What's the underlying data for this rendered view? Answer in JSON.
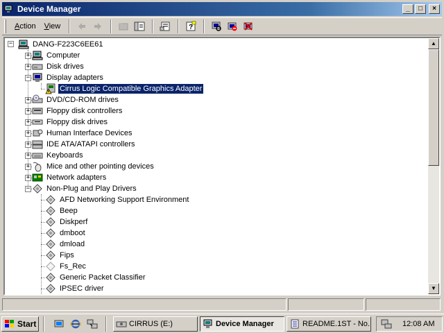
{
  "window": {
    "title": "Device Manager",
    "icon": "device-manager-icon",
    "controls": {
      "minimize": "_",
      "maximize": "□",
      "close": "×"
    }
  },
  "toolbar": {
    "menu": [
      {
        "label": "Action",
        "accel": "A"
      },
      {
        "label": "View",
        "accel": "V"
      }
    ],
    "buttons": [
      {
        "name": "back-icon",
        "enabled": false
      },
      {
        "name": "forward-icon",
        "enabled": false
      },
      {
        "name": "up-folder-icon",
        "enabled": false
      },
      {
        "name": "show-hide-tree-icon",
        "enabled": true
      },
      {
        "name": "properties-icon",
        "enabled": true
      },
      {
        "name": "help-icon",
        "enabled": true
      },
      {
        "name": "scan-hardware-icon",
        "enabled": true
      },
      {
        "name": "disable-device-icon",
        "enabled": true
      },
      {
        "name": "uninstall-device-icon",
        "enabled": true
      }
    ]
  },
  "tree": {
    "root": "DANG-F223C6EE61",
    "items": [
      {
        "label": "Computer",
        "level": 1,
        "expander": "+",
        "icon": "computer-icon"
      },
      {
        "label": "Disk drives",
        "level": 1,
        "expander": "+",
        "icon": "disk-drive-icon"
      },
      {
        "label": "Display adapters",
        "level": 1,
        "expander": "-",
        "icon": "display-adapter-icon"
      },
      {
        "label": "Cirrus Logic Compatible Graphics Adapter",
        "level": 2,
        "expander": "",
        "icon": "warning-adapter-icon",
        "selected": true
      },
      {
        "label": "DVD/CD-ROM drives",
        "level": 1,
        "expander": "+",
        "icon": "cdrom-icon"
      },
      {
        "label": "Floppy disk controllers",
        "level": 1,
        "expander": "+",
        "icon": "floppy-controller-icon"
      },
      {
        "label": "Floppy disk drives",
        "level": 1,
        "expander": "+",
        "icon": "floppy-drive-icon"
      },
      {
        "label": "Human Interface Devices",
        "level": 1,
        "expander": "+",
        "icon": "hid-icon"
      },
      {
        "label": "IDE ATA/ATAPI controllers",
        "level": 1,
        "expander": "+",
        "icon": "ide-controller-icon"
      },
      {
        "label": "Keyboards",
        "level": 1,
        "expander": "+",
        "icon": "keyboard-icon"
      },
      {
        "label": "Mice and other pointing devices",
        "level": 1,
        "expander": "+",
        "icon": "mouse-icon"
      },
      {
        "label": "Network adapters",
        "level": 1,
        "expander": "+",
        "icon": "network-adapter-icon"
      },
      {
        "label": "Non-Plug and Play Drivers",
        "level": 1,
        "expander": "-",
        "icon": "driver-icon"
      },
      {
        "label": "AFD Networking Support Environment",
        "level": 2,
        "expander": "",
        "icon": "driver-icon"
      },
      {
        "label": "Beep",
        "level": 2,
        "expander": "",
        "icon": "driver-icon"
      },
      {
        "label": "Diskperf",
        "level": 2,
        "expander": "",
        "icon": "driver-icon"
      },
      {
        "label": "dmboot",
        "level": 2,
        "expander": "",
        "icon": "driver-icon"
      },
      {
        "label": "dmload",
        "level": 2,
        "expander": "",
        "icon": "driver-icon"
      },
      {
        "label": "Fips",
        "level": 2,
        "expander": "",
        "icon": "driver-icon"
      },
      {
        "label": "Fs_Rec",
        "level": 2,
        "expander": "",
        "icon": "driver-disabled-icon"
      },
      {
        "label": "Generic Packet Classifier",
        "level": 2,
        "expander": "",
        "icon": "driver-icon"
      },
      {
        "label": "IPSEC driver",
        "level": 2,
        "expander": "",
        "icon": "driver-icon"
      }
    ]
  },
  "taskbar": {
    "start_label": "Start",
    "quick_launch": [
      "show-desktop-icon",
      "internet-explorer-icon",
      "network-icon"
    ],
    "tasks": [
      {
        "label": "CIRRUS (E:)",
        "icon": "drive-icon",
        "active": false
      },
      {
        "label": "Device Manager",
        "icon": "device-manager-icon",
        "active": true
      },
      {
        "label": "README.1ST - No...",
        "icon": "notepad-icon",
        "active": false
      }
    ],
    "clock": "12:08 AM",
    "tray_icons": [
      "network-tray-icon"
    ]
  },
  "colors": {
    "title_active": "#0a246a",
    "selection": "#0a246a",
    "face": "#d4d0c8"
  }
}
